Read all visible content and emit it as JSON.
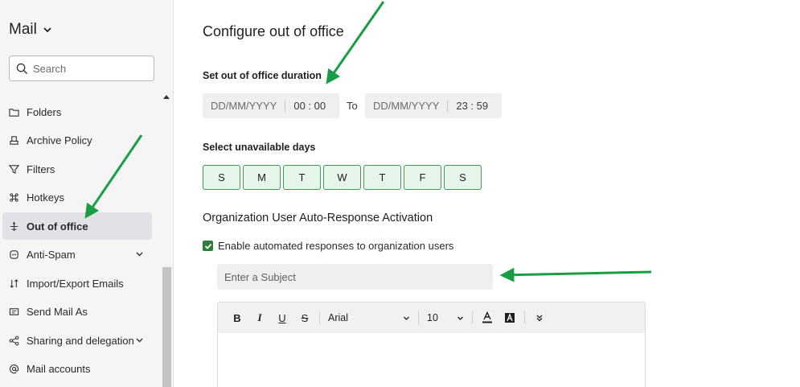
{
  "sidebar": {
    "title": "Mail",
    "search_placeholder": "Search",
    "items": [
      {
        "label": "Folders",
        "icon": "folder-icon"
      },
      {
        "label": "Archive Policy",
        "icon": "archive-icon"
      },
      {
        "label": "Filters",
        "icon": "filter-icon"
      },
      {
        "label": "Hotkeys",
        "icon": "command-key-icon"
      },
      {
        "label": "Out of office",
        "icon": "airplane-icon",
        "active": true
      },
      {
        "label": "Anti-Spam",
        "icon": "shield-icon",
        "expandable": true
      },
      {
        "label": "Import/Export Emails",
        "icon": "import-export-icon"
      },
      {
        "label": "Send Mail As",
        "icon": "send-as-icon"
      },
      {
        "label": "Sharing and delegation",
        "icon": "share-icon",
        "expandable": true
      },
      {
        "label": "Mail accounts",
        "icon": "at-icon"
      }
    ]
  },
  "main": {
    "title": "Configure out of office",
    "duration_label": "Set out of office duration",
    "from_date_placeholder": "DD/MM/YYYY",
    "from_time": "00 : 00",
    "to_label": "To",
    "to_date_placeholder": "DD/MM/YYYY",
    "to_time": "23 : 59",
    "days_label": "Select unavailable days",
    "days": [
      "S",
      "M",
      "T",
      "W",
      "T",
      "F",
      "S"
    ],
    "auto_response_heading": "Organization User Auto-Response Activation",
    "enable_label": "Enable automated responses to organization users",
    "enable_checked": true,
    "subject_placeholder": "Enter a Subject",
    "editor": {
      "bold": "B",
      "italic": "I",
      "underline": "U",
      "strike": "S",
      "font": "Arial",
      "size": "10"
    }
  },
  "colors": {
    "accent_green": "#2e7d3c",
    "day_fill": "#e6f5ea",
    "annotation_arrow": "#1a9e45"
  }
}
